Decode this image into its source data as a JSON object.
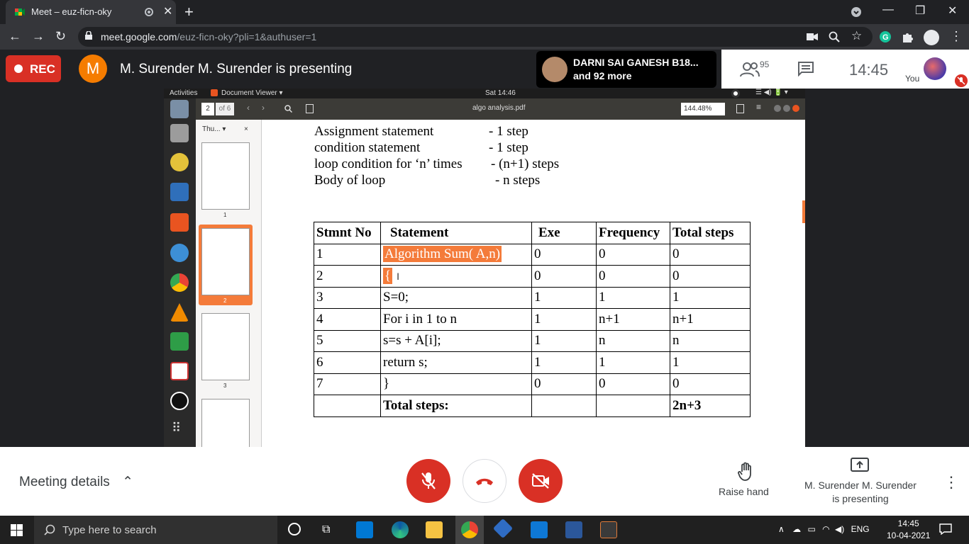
{
  "browser": {
    "tab_title": "Meet – euz-ficn-oky",
    "new_tab": "+",
    "url_domain": "meet.google.com",
    "url_path": "/euz-ficn-oky?pli=1&authuser=1",
    "minimize": "—",
    "restore": "❐",
    "close": "✕"
  },
  "meet_top": {
    "rec_label": "REC",
    "presenter_initial": "M",
    "presenting_text": "M. Surender M. Surender is presenting",
    "participant_name": "DARNI SAI GANESH B18...",
    "participant_more": "and 92 more",
    "people_count": "95",
    "time": "14:45",
    "you_label": "You"
  },
  "shared_screen": {
    "activities": "Activities",
    "app_menu": "Document Viewer ▾",
    "date_time": "Sat 14:46",
    "page_num": "2",
    "page_of": "of 6",
    "doc_title": "algo analysis.pdf",
    "zoom": "144.48%",
    "sidebar_mode": "Thu... ▾",
    "thumb_labels": [
      "1",
      "2",
      "3"
    ],
    "doc_lines": [
      {
        "left": "Assignment statement",
        "right": "- 1 step"
      },
      {
        "left": "condition statement",
        "right": "- 1 step"
      },
      {
        "left": "loop condition for ‘n’ times",
        "right": "- (n+1) steps"
      },
      {
        "left": "Body of loop",
        "right": "- n steps"
      }
    ],
    "table": {
      "headers": [
        "Stmnt No",
        "Statement",
        "Exe",
        "Frequency",
        "Total steps"
      ],
      "rows": [
        [
          "1",
          "Algorithm Sum( A,n)",
          "0",
          "0",
          "0"
        ],
        [
          "2",
          "{",
          "0",
          "0",
          "0"
        ],
        [
          "3",
          "S=0;",
          "1",
          "1",
          "1"
        ],
        [
          "4",
          "For i in 1 to n",
          "1",
          "n+1",
          "n+1"
        ],
        [
          "5",
          "s=s + A[i];",
          "1",
          "n",
          "n"
        ],
        [
          "6",
          "return s;",
          "1",
          "1",
          "1"
        ],
        [
          "7",
          "}",
          "0",
          "0",
          "0"
        ],
        [
          "",
          "Total steps:",
          "",
          "",
          "2n+3"
        ]
      ]
    }
  },
  "meet_bottom": {
    "meeting_details": "Meeting details",
    "raise_hand": "Raise hand",
    "presenting_line1": "M. Surender M. Surender",
    "presenting_line2": "is presenting"
  },
  "taskbar": {
    "search_placeholder": "Type here to search",
    "language": "ENG",
    "time": "14:45",
    "date": "10-04-2021"
  },
  "colors": {
    "rec_red": "#d93025",
    "presenter_orange": "#f57c00",
    "highlight_orange": "#f47b3a"
  }
}
